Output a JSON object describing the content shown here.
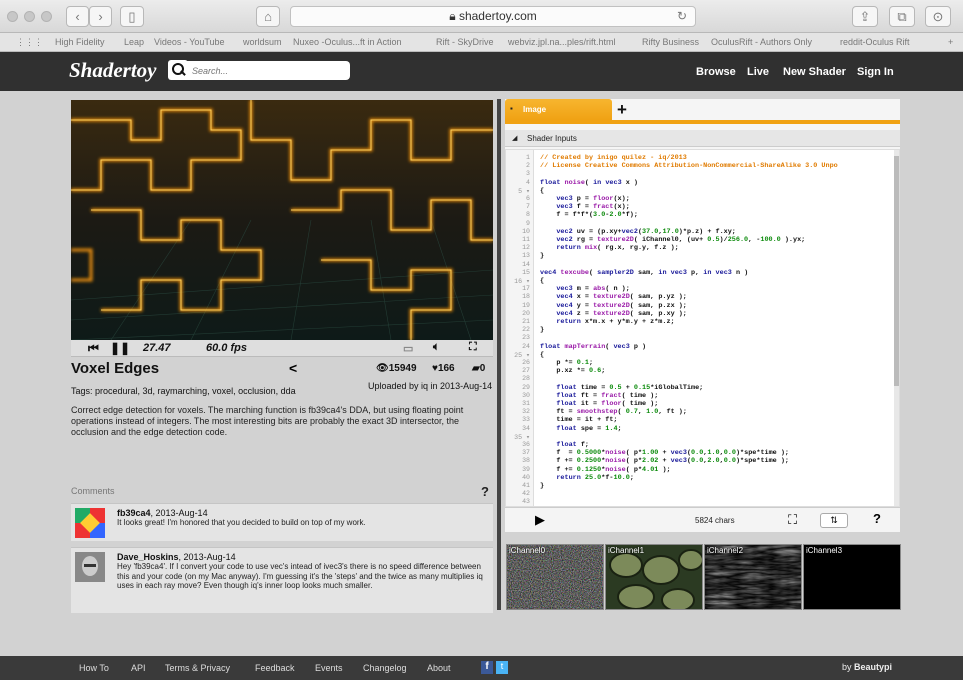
{
  "browser": {
    "url": "shadertoy.com",
    "bookmarks": [
      "High Fidelity",
      "Leap",
      "Videos - YouTube",
      "worldsum",
      "Nuxeo -Oculus...ft in Action",
      "Rift - SkyDrive",
      "webviz.jpl.na...ples/rift.html",
      "Rifty Business",
      "OculusRift - Authors Only",
      "reddit-Oculus Rift"
    ]
  },
  "site": {
    "logo": "Shadertoy",
    "search_placeholder": "Search...",
    "nav": [
      "Browse",
      "Live",
      "New Shader",
      "Sign In"
    ]
  },
  "player": {
    "time": "27.47",
    "fps": "60.0 fps"
  },
  "shader": {
    "title": "Voxel Edges",
    "views": "15949",
    "likes": "166",
    "comments": "0",
    "uploaded": "Uploaded by iq in 2013-Aug-14",
    "tags": "Tags: procedural, 3d, raymarching, voxel, occlusion, dda",
    "description": "Correct edge detection for voxels. The marching function is fb39ca4's DDA, but using floating point operations instead of integers. The most interesting bits are probably the exact 3D intersector, the occlusion and the edge detection code."
  },
  "comments": {
    "label": "Comments",
    "help": "?",
    "items": [
      {
        "author": "fb39ca4",
        "date": ", 2013-Aug-14",
        "text": "It looks great! I'm honored that you decided to build on top of my work."
      },
      {
        "author": "Dave_Hoskins",
        "date": ", 2013-Aug-14",
        "text": "Hey 'fb39ca4'. If I convert your code to use vec's intead of ivec3's there is no speed difference between this and your code (on my Mac anyway). I'm guessing it's the 'steps' and the twice as many multiplies iq uses in each ray move? Even though iq's inner loop looks much smaller."
      }
    ]
  },
  "editor": {
    "tab": "Image",
    "add_tab": "+",
    "inputs_label": "Shader Inputs",
    "chars": "5824 chars",
    "help": "?",
    "code": [
      "// Created by inigo quilez - iq/2013",
      "// License Creative Commons Attribution-NonCommercial-ShareAlike 3.0 Unpo",
      "",
      "float noise( in vec3 x )",
      "{",
      "    vec3 p = floor(x);",
      "    vec3 f = fract(x);",
      "    f = f*f*(3.0-2.0*f);",
      "",
      "    vec2 uv = (p.xy+vec2(37.0,17.0)*p.z) + f.xy;",
      "    vec2 rg = texture2D( iChannel0, (uv+ 0.5)/256.0, -100.0 ).yx;",
      "    return mix( rg.x, rg.y, f.z );",
      "}",
      "",
      "vec4 texcube( sampler2D sam, in vec3 p, in vec3 n )",
      "{",
      "    vec3 m = abs( n );",
      "    vec4 x = texture2D( sam, p.yz );",
      "    vec4 y = texture2D( sam, p.zx );",
      "    vec4 z = texture2D( sam, p.xy );",
      "    return x*m.x + y*m.y + z*m.z;",
      "}",
      "",
      "float mapTerrain( vec3 p )",
      "{",
      "    p *= 0.1;",
      "    p.xz *= 0.6;",
      "",
      "    float time = 0.5 + 0.15*iGlobalTime;",
      "    float ft = fract( time );",
      "    float it = floor( time );",
      "    ft = smoothstep( 0.7, 1.0, ft );",
      "    time = it + ft;",
      "    float spe = 1.4;",
      "",
      "    float f;",
      "    f  = 0.5000*noise( p*1.00 + vec3(0.0,1.0,0.0)*spe*time );",
      "    f += 0.2500*noise( p*2.02 + vec3(0.0,2.0,0.0)*spe*time );",
      "    f += 0.1250*noise( p*4.01 );",
      "    return 25.0*f-10.0;",
      "}",
      "",
      ""
    ],
    "fold_lines": [
      5,
      16,
      25,
      35
    ]
  },
  "channels": [
    "iChannel0",
    "iChannel1",
    "iChannel2",
    "iChannel3"
  ],
  "footer": {
    "links": [
      "How To",
      "API",
      "Terms & Privacy",
      "Feedback",
      "Events",
      "Changelog",
      "About"
    ],
    "credit_prefix": "by ",
    "credit_name": "Beautypi"
  },
  "colors": {
    "accent": "#f0a214",
    "topbar": "#303030",
    "page": "#d2d2d2"
  }
}
